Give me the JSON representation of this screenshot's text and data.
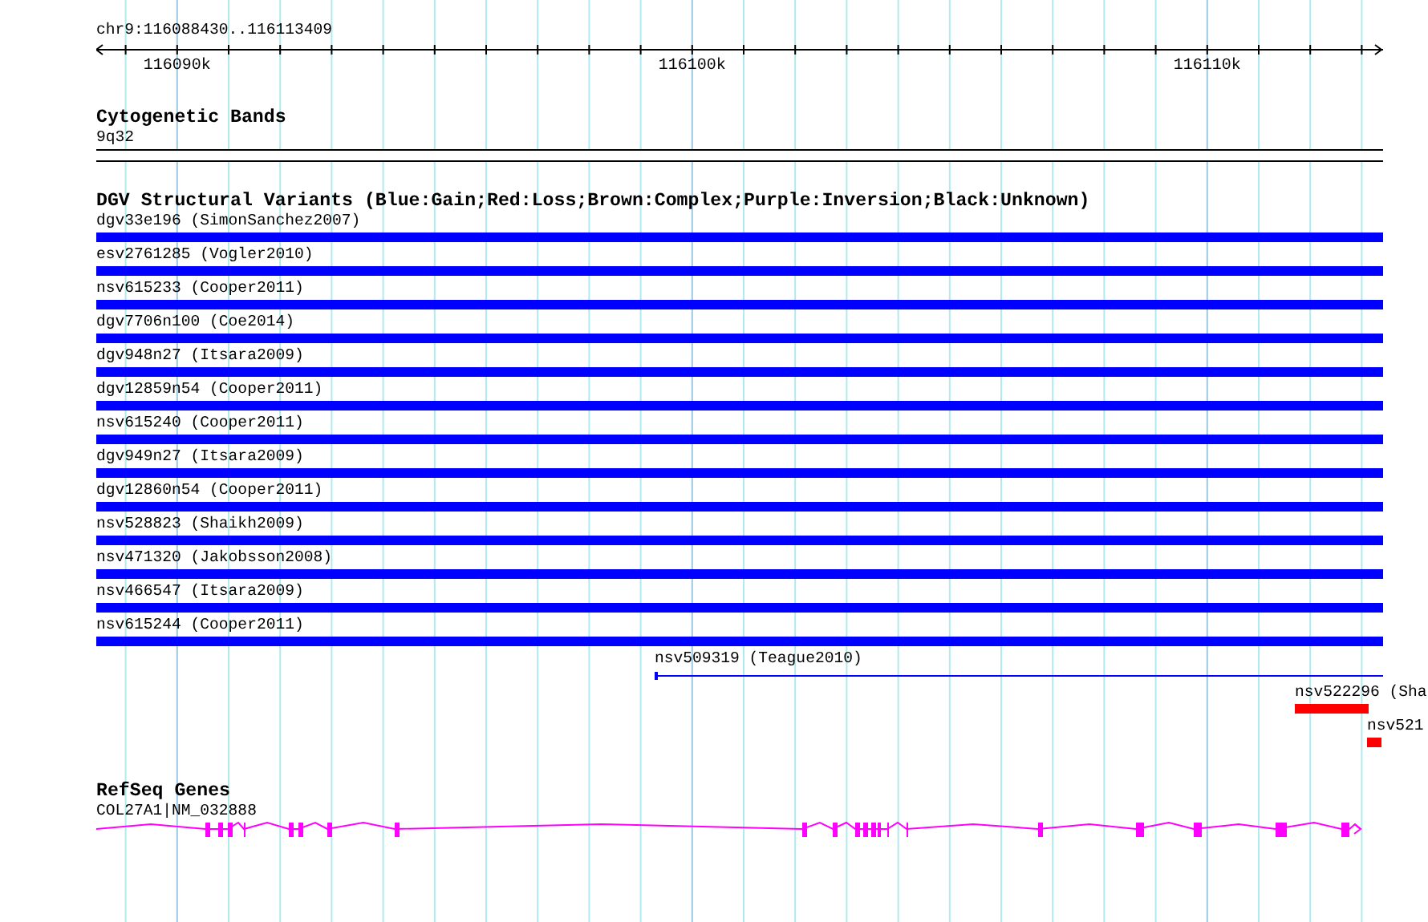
{
  "ruler": {
    "range": "chr9:116088430..116113409",
    "ticks": [
      "116090k",
      "116100k",
      "116110k"
    ]
  },
  "tracks": [
    {
      "kind": "cytoband",
      "title": "Cytogenetic Bands",
      "features": [
        {
          "label": "9q32"
        }
      ]
    },
    {
      "kind": "variants",
      "title": "DGV Structural Variants (Blue:Gain;Red:Loss;Brown:Complex;Purple:Inversion;Black:Unknown)",
      "features": [
        {
          "label": "dgv33e196 (SimonSanchez2007)",
          "kind": "bar",
          "color": "#0000ff"
        },
        {
          "label": "esv2761285 (Vogler2010)",
          "kind": "bar",
          "color": "#0000ff"
        },
        {
          "label": "nsv615233 (Cooper2011)",
          "kind": "bar",
          "color": "#0000ff"
        },
        {
          "label": "dgv7706n100 (Coe2014)",
          "kind": "bar",
          "color": "#0000ff"
        },
        {
          "label": "dgv948n27 (Itsara2009)",
          "kind": "bar",
          "color": "#0000ff"
        },
        {
          "label": "dgv12859n54 (Cooper2011)",
          "kind": "bar",
          "color": "#0000ff"
        },
        {
          "label": "nsv615240 (Cooper2011)",
          "kind": "bar",
          "color": "#0000ff"
        },
        {
          "label": "dgv949n27 (Itsara2009)",
          "kind": "bar",
          "color": "#0000ff"
        },
        {
          "label": "dgv12860n54 (Cooper2011)",
          "kind": "bar",
          "color": "#0000ff"
        },
        {
          "label": "nsv528823 (Shaikh2009)",
          "kind": "bar",
          "color": "#0000ff"
        },
        {
          "label": "nsv471320 (Jakobsson2008)",
          "kind": "bar",
          "color": "#0000ff"
        },
        {
          "label": "nsv466547 (Itsara2009)",
          "kind": "bar",
          "color": "#0000ff"
        },
        {
          "label": "nsv615244 (Cooper2011)",
          "kind": "bar",
          "color": "#0000ff"
        },
        {
          "label": "nsv509319 (Teague2010)",
          "kind": "line",
          "color": "#0000ff"
        },
        {
          "label": "nsv522296 (Sha",
          "kind": "bar",
          "color": "#ff0000"
        },
        {
          "label": "nsv521",
          "kind": "bar",
          "color": "#ff0000"
        }
      ]
    },
    {
      "kind": "gene",
      "title": "RefSeq Genes",
      "features": [
        {
          "label": "COL27A1|NM_032888"
        }
      ]
    }
  ]
}
